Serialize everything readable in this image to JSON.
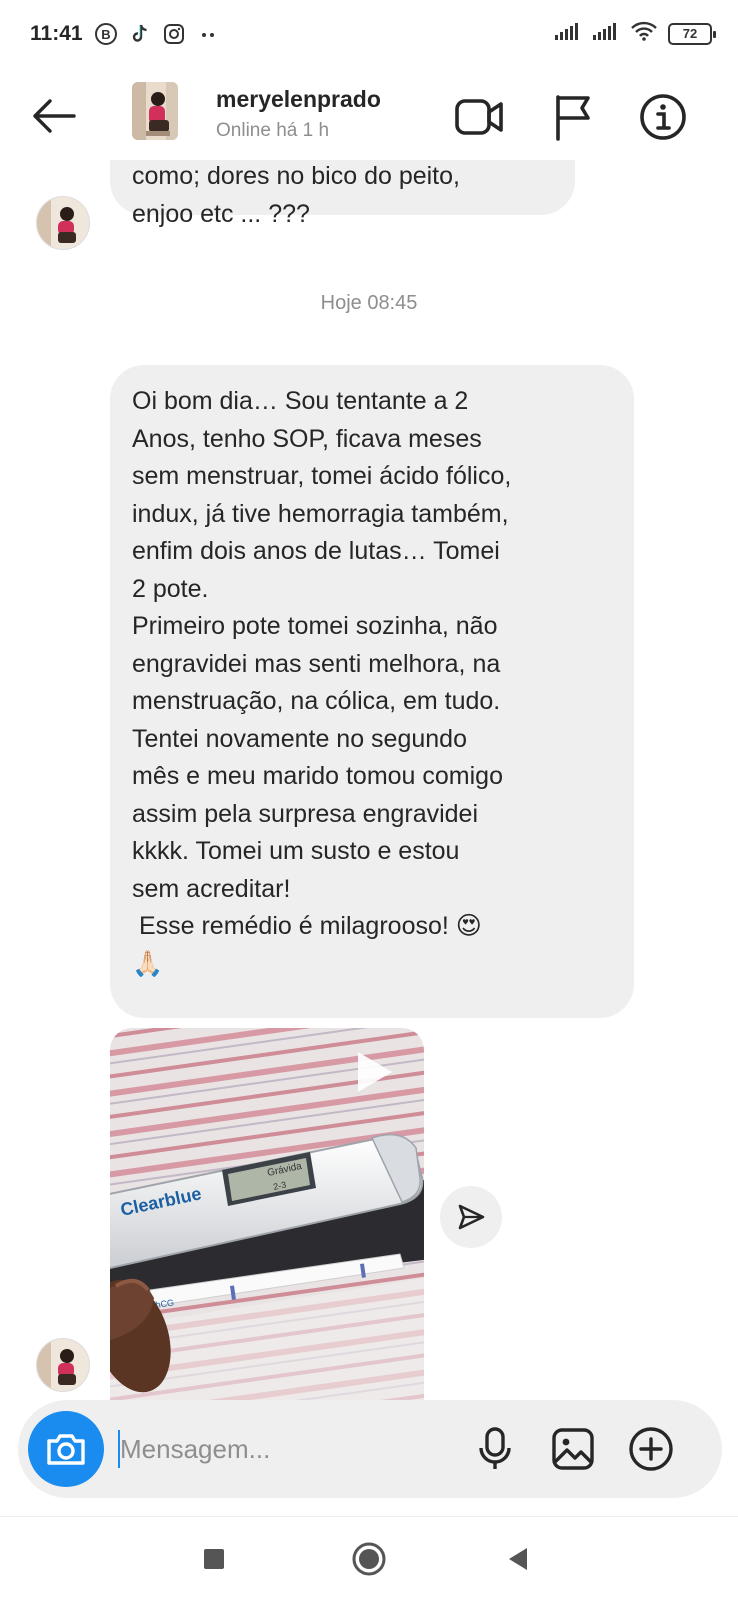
{
  "status_bar": {
    "time": "11:41",
    "battery": "72",
    "left_icons": [
      "b-circle-icon",
      "tiktok-icon",
      "instagram-icon",
      "more-dots-icon"
    ],
    "right_icons": [
      "signal-icon",
      "signal-icon",
      "wifi-icon",
      "battery-icon"
    ]
  },
  "header": {
    "username": "meryelenprado",
    "status": "Online há 1 h",
    "icons": [
      "back-arrow-icon",
      "video-call-icon",
      "flag-icon",
      "info-icon"
    ]
  },
  "messages": [
    {
      "text": "como; dores no bico do peito,\nenjoo etc ... ???"
    },
    {
      "text": "Oi bom dia… Sou tentante a 2\nAnos, tenho SOP, ficava meses\nsem menstruar, tomei ácido fólico,\nindux, já tive hemorragia também,\nenfim dois anos de lutas… Tomei\n2 pote.\nPrimeiro pote tomei sozinha, não\nengravidei mas senti melhora, na\nmenstruação, na cólica, em tudo.\nTentei novamente no segundo\nmês e meu marido tomou comigo\nassim pela surpresa engravidei\nkkkk. Tomei um susto e estou\nsem acreditar!\n Esse remédio é milagrooso! 😍\n🙏🏻"
    }
  ],
  "timestamp": "Hoje 08:45",
  "media": {
    "brand": "Clearblue",
    "screen_line1": "Grávida",
    "screen_line2": "2-3",
    "strip_label": "hCG",
    "type": "video"
  },
  "composer": {
    "placeholder": "Mensagem...",
    "value": "",
    "icons": [
      "camera-icon",
      "microphone-icon",
      "gallery-icon",
      "plus-circle-icon"
    ]
  },
  "nav": {
    "icons": [
      "recents-square-icon",
      "home-circle-icon",
      "back-triangle-icon"
    ]
  },
  "colors": {
    "bubble": "#efefef",
    "accent": "#1a8cf0",
    "muted_text": "#8e8e8e",
    "text": "#262626"
  }
}
